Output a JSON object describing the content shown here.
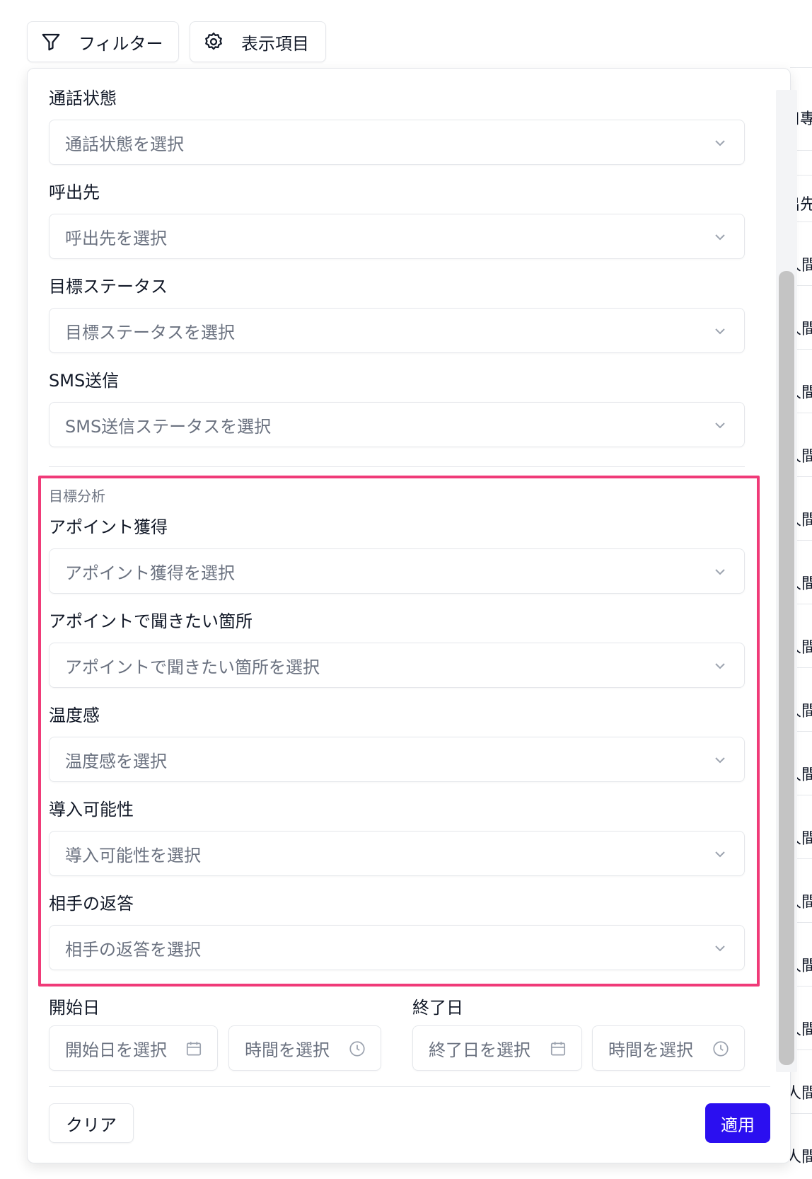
{
  "toolbar": {
    "filter_label": "フィルター",
    "columns_label": "表示項目"
  },
  "background_table": {
    "header_1": "口專",
    "header_2": "出先",
    "cell": "人間"
  },
  "filters": {
    "call_status": {
      "label": "通話状態",
      "placeholder": "通話状態を選択"
    },
    "destination": {
      "label": "呼出先",
      "placeholder": "呼出先を選択"
    },
    "goal_status": {
      "label": "目標ステータス",
      "placeholder": "目標ステータスを選択"
    },
    "sms": {
      "label": "SMS送信",
      "placeholder": "SMS送信ステータスを選択"
    }
  },
  "goal_analysis": {
    "section_title": "目標分析",
    "appointment": {
      "label": "アポイント獲得",
      "placeholder": "アポイント獲得を選択"
    },
    "appointment_question": {
      "label": "アポイントで聞きたい箇所",
      "placeholder": "アポイントで聞きたい箇所を選択"
    },
    "temperature": {
      "label": "温度感",
      "placeholder": "温度感を選択"
    },
    "adoption": {
      "label": "導入可能性",
      "placeholder": "導入可能性を選択"
    },
    "response": {
      "label": "相手の返答",
      "placeholder": "相手の返答を選択"
    }
  },
  "dates": {
    "start_label": "開始日",
    "start_date_placeholder": "開始日を選択",
    "start_time_placeholder": "時間を選択",
    "end_label": "終了日",
    "end_date_placeholder": "終了日を選択",
    "end_time_placeholder": "時間を選択"
  },
  "actions": {
    "clear_label": "クリア",
    "apply_label": "適用"
  },
  "colors": {
    "highlight": "#f03a78",
    "apply_button": "#2b0ff0"
  }
}
